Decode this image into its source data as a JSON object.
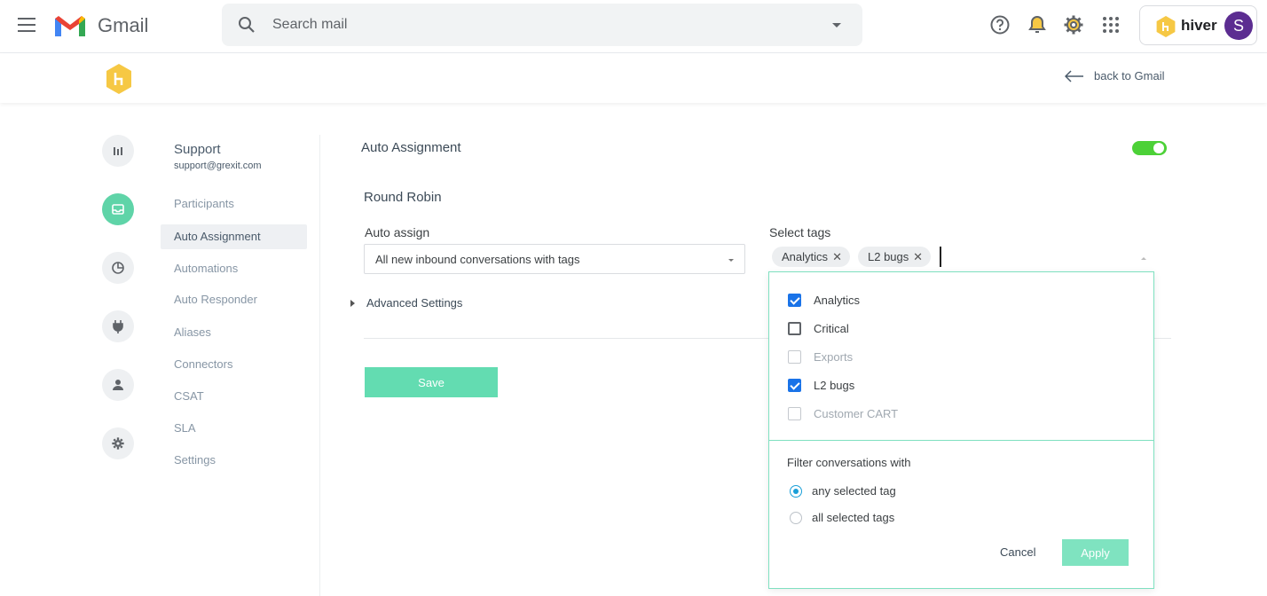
{
  "app": {
    "name": "Gmail"
  },
  "search": {
    "placeholder": "Search mail"
  },
  "hiver": {
    "brand": "hiver",
    "avatar_letter": "S"
  },
  "subbar": {
    "back_label": "back to Gmail"
  },
  "sidebar": {
    "icons": [
      "bar-chart-icon",
      "inbox-icon",
      "pie-chart-icon",
      "plug-icon",
      "user-icon",
      "gear-icon"
    ],
    "active_icon": "inbox-icon"
  },
  "nav": {
    "title": "Support",
    "email": "support@grexit.com",
    "items": [
      {
        "label": "Participants"
      },
      {
        "label": "Auto Assignment",
        "active": true
      },
      {
        "label": "Automations"
      },
      {
        "label": "Auto Responder"
      },
      {
        "label": "Aliases"
      },
      {
        "label": "Connectors"
      },
      {
        "label": "CSAT"
      },
      {
        "label": "SLA"
      },
      {
        "label": "Settings"
      }
    ]
  },
  "main": {
    "title": "Auto Assignment",
    "enabled": true,
    "subtitle": "Round Robin",
    "auto_assign_label": "Auto assign",
    "auto_assign_value": "All new inbound conversations with tags",
    "select_tags_label": "Select tags",
    "advanced_label": "Advanced Settings",
    "save_label": "Save"
  },
  "tags": {
    "selected": [
      "Analytics",
      "L2 bugs"
    ],
    "options": [
      {
        "label": "Analytics",
        "checked": true,
        "disabled": false
      },
      {
        "label": "Critical",
        "checked": false,
        "disabled": false
      },
      {
        "label": "Exports",
        "checked": false,
        "disabled": true
      },
      {
        "label": "L2 bugs",
        "checked": true,
        "disabled": false
      },
      {
        "label": "Customer CART",
        "checked": false,
        "disabled": true
      }
    ],
    "filter_label": "Filter conversations with",
    "filter_options": [
      {
        "label": "any selected tag",
        "selected": true
      },
      {
        "label": "all selected tags",
        "selected": false
      }
    ],
    "cancel_label": "Cancel",
    "apply_label": "Apply"
  },
  "colors": {
    "accent": "#63dcb1",
    "toggle_on": "#4cd137",
    "checkbox": "#1a73e8",
    "avatar": "#5c2d91",
    "hiver_yellow": "#f6c844"
  }
}
